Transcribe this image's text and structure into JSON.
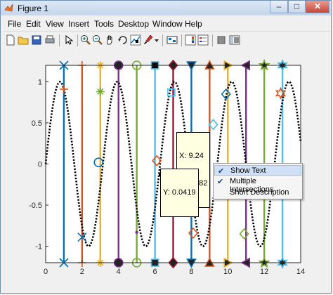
{
  "window": {
    "title": "Figure 1"
  },
  "menu": [
    "File",
    "Edit",
    "View",
    "Insert",
    "Tools",
    "Desktop",
    "Window",
    "Help"
  ],
  "toolbar_icons": [
    "new-figure-icon",
    "open-file-icon",
    "save-icon",
    "print-icon",
    "edit-plot-icon",
    "zoom-in-icon",
    "zoom-out-icon",
    "pan-icon",
    "rotate-3d-icon",
    "data-cursor-icon",
    "brush-icon",
    "link-plot-icon",
    "colorbar-icon",
    "legend-icon",
    "hide-plot-tools-icon",
    "show-plot-tools-icon"
  ],
  "datatips": [
    {
      "x_label": "X: 9.24",
      "y_label": "Y: 0.482"
    },
    {
      "y_label": "Y: 0.0419"
    }
  ],
  "context_menu": [
    {
      "label": "Show Text",
      "checked": true
    },
    {
      "label": "Multiple Intersections",
      "checked": true
    },
    {
      "label": "Short Description",
      "checked": false
    }
  ],
  "chart_data": {
    "type": "line",
    "xlim": [
      0,
      14
    ],
    "ylim": [
      -1.2,
      1.2
    ],
    "xticks": [
      "0",
      "2",
      "4",
      "6",
      "8",
      "10",
      "12",
      "14"
    ],
    "yticks": [
      "1",
      "0.5",
      "0",
      "-0.5",
      "-1"
    ],
    "curve": {
      "function": "sin",
      "style": "dotted",
      "color": "#000000",
      "x_range": [
        0,
        14
      ],
      "frequency": 2.0,
      "phase": 0
    },
    "vertical_lines": [
      {
        "x": 1.0,
        "color": "#0072bd",
        "marker": "x"
      },
      {
        "x": 2.0,
        "color": "#d95319",
        "marker": "+"
      },
      {
        "x": 3.0,
        "color": "#edb120",
        "marker": "*"
      },
      {
        "x": 4.0,
        "color": "#7e2f8e",
        "marker": "circle"
      },
      {
        "x": 5.0,
        "color": "#77ac30",
        "marker": "."
      },
      {
        "x": 6.0,
        "color": "#4dbeee",
        "marker": "square"
      },
      {
        "x": 7.0,
        "color": "#a2142f",
        "marker": "diamond"
      },
      {
        "x": 8.0,
        "color": "#0072bd",
        "marker": "triangle-down"
      },
      {
        "x": 9.0,
        "color": "#d95319",
        "marker": "triangle-up"
      },
      {
        "x": 10.0,
        "color": "#edb120",
        "marker": "triangle-right"
      },
      {
        "x": 11.0,
        "color": "#7e2f8e",
        "marker": "triangle-left"
      },
      {
        "x": 12.0,
        "color": "#77ac30",
        "marker": "pentagram"
      },
      {
        "x": 13.0,
        "color": "#4dbeee",
        "marker": "hexagram"
      }
    ],
    "intersections": [
      {
        "x": 1.0,
        "y": 0.91,
        "color": "#d95319",
        "marker": "+"
      },
      {
        "x": 2.0,
        "y": -0.89,
        "color": "#0072bd",
        "marker": "x"
      },
      {
        "x": 2.9,
        "y": 0.02,
        "color": "#0072bd",
        "marker": "circle"
      },
      {
        "x": 3.0,
        "y": 0.88,
        "color": "#77ac30",
        "marker": "*"
      },
      {
        "x": 5.0,
        "y": -0.83,
        "color": "#7e2f8e",
        "marker": "."
      },
      {
        "x": 6.1,
        "y": 0.04,
        "color": "#d95319",
        "marker": "diamond"
      },
      {
        "x": 6.9,
        "y": 0.87,
        "color": "#4dbeee",
        "marker": "square"
      },
      {
        "x": 8.1,
        "y": -0.84,
        "color": "#d95319",
        "marker": "diamond"
      },
      {
        "x": 9.2,
        "y": 0.48,
        "color": "#4dbeee",
        "marker": "diamond"
      },
      {
        "x": 9.9,
        "y": 0.85,
        "color": "#0072bd",
        "marker": "diamond"
      },
      {
        "x": 10.9,
        "y": -0.85,
        "color": "#77ac30",
        "marker": "diamond"
      },
      {
        "x": 12.9,
        "y": 0.86,
        "color": "#d95319",
        "marker": "hexagram"
      }
    ]
  }
}
